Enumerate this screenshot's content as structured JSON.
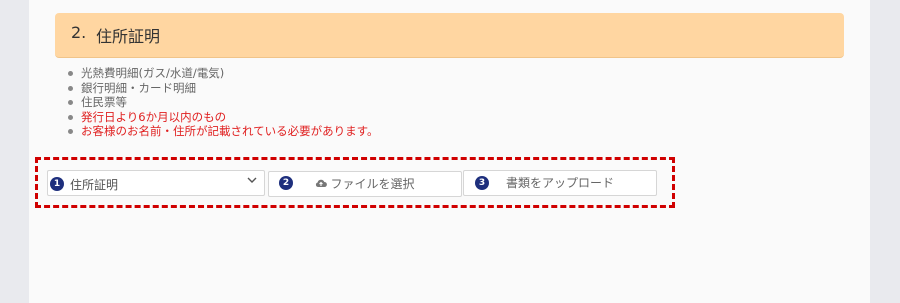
{
  "section": {
    "number": "2.",
    "title": "住所証明"
  },
  "requirements": {
    "items": [
      "光熱費明細(ガス/水道/電気)",
      "銀行明細・カード明細",
      "住民票等"
    ],
    "warnings": [
      "発行日より6か月以内のもの",
      "お客様のお名前・住所が記載されている必要があります。"
    ]
  },
  "upload": {
    "steps": [
      "1",
      "2",
      "3"
    ],
    "document_type": {
      "selected": "住所証明"
    },
    "choose_file_label": "ファイルを選択",
    "upload_label": "書類をアップロード"
  },
  "colors": {
    "header_bg": "#ffd6a1",
    "warning_text": "#e02020",
    "badge_bg": "#1e2f7d",
    "highlight_border": "#d00000"
  },
  "icons": {
    "select": "chevron-down-icon",
    "choose_file": "cloud-upload-icon"
  }
}
